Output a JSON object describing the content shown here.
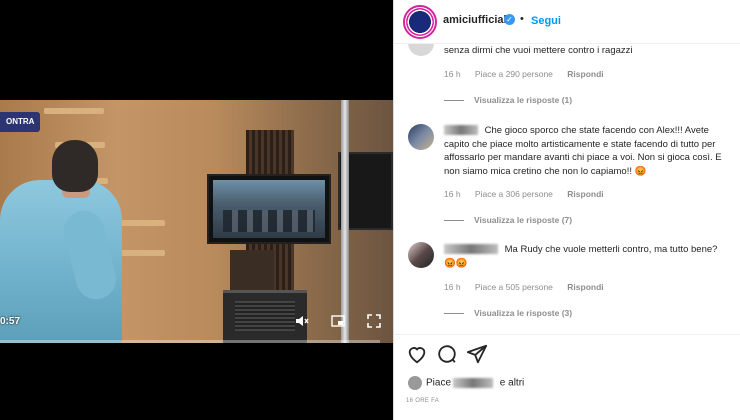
{
  "video": {
    "badge_text": "ONTRA",
    "current_time": "0:57",
    "progress": 0.0
  },
  "header": {
    "username": "amiciufficiale",
    "separator": "•",
    "follow_label": "Segui"
  },
  "comments": [
    {
      "text": "senza dirmi che vuoi mettere contro i ragazzi",
      "age": "16 h",
      "likes": "Piace a 290 persone",
      "reply_label": "Rispondi",
      "view_replies": "Visualizza le risposte (1)"
    },
    {
      "text": "Che gioco sporco che state facendo con Alex!!! Avete capito che piace molto artisticamente e state facendo di tutto per affossarlo per mandare avanti chi piace a voi. Non si gioca così. E non siamo mica cretino che non lo capiamo!! 😡",
      "age": "16 h",
      "likes": "Piace a 306 persone",
      "reply_label": "Rispondi",
      "view_replies": "Visualizza le risposte (7)"
    },
    {
      "text": "Ma Rudy che vuole metterli contro, ma tutto bene?😡😡",
      "age": "16 h",
      "likes": "Piace a 505 persone",
      "reply_label": "Rispondi",
      "view_replies": "Visualizza le risposte (3)"
    }
  ],
  "footer": {
    "likes_prefix": "Piace",
    "likes_suffix": "e altri",
    "posted_ago": "16 ORE FA"
  },
  "icons": [
    "heart-icon",
    "comment-icon",
    "share-icon",
    "mute-icon",
    "pip-icon",
    "fullscreen-icon",
    "verified-icon"
  ],
  "colors": {
    "link_blue": "#0095f6",
    "badge_navy": "#2c3472",
    "meta_gray": "#8e8e8e"
  }
}
